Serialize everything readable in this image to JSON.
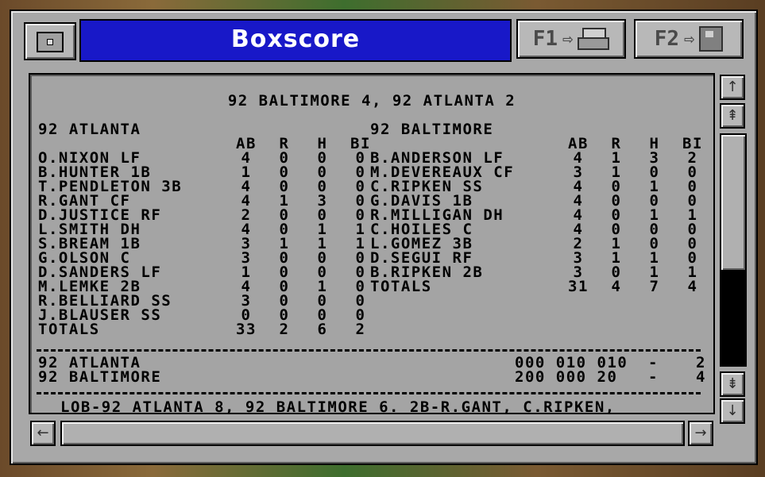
{
  "window": {
    "title": "Boxscore",
    "f1_label": "F1",
    "f2_label": "F2",
    "f1_arrow": "⇨",
    "f2_arrow": "⇨"
  },
  "headline": "92 BALTIMORE 4, 92 ATLANTA 2",
  "columns": {
    "ab": "AB",
    "r": "R",
    "h": "H",
    "bi": "BI"
  },
  "away": {
    "team": "92 ATLANTA",
    "players": [
      {
        "name": "O.NIXON LF",
        "ab": "4",
        "r": "0",
        "h": "0",
        "bi": "0"
      },
      {
        "name": "B.HUNTER 1B",
        "ab": "1",
        "r": "0",
        "h": "0",
        "bi": "0"
      },
      {
        "name": "T.PENDLETON 3B",
        "ab": "4",
        "r": "0",
        "h": "0",
        "bi": "0"
      },
      {
        "name": "R.GANT CF",
        "ab": "4",
        "r": "1",
        "h": "3",
        "bi": "0"
      },
      {
        "name": "D.JUSTICE RF",
        "ab": "2",
        "r": "0",
        "h": "0",
        "bi": "0"
      },
      {
        "name": "L.SMITH DH",
        "ab": "4",
        "r": "0",
        "h": "1",
        "bi": "1"
      },
      {
        "name": "S.BREAM 1B",
        "ab": "3",
        "r": "1",
        "h": "1",
        "bi": "1"
      },
      {
        "name": "G.OLSON C",
        "ab": "3",
        "r": "0",
        "h": "0",
        "bi": "0"
      },
      {
        "name": "D.SANDERS LF",
        "ab": "1",
        "r": "0",
        "h": "0",
        "bi": "0"
      },
      {
        "name": "M.LEMKE 2B",
        "ab": "4",
        "r": "0",
        "h": "1",
        "bi": "0"
      },
      {
        "name": "R.BELLIARD SS",
        "ab": "3",
        "r": "0",
        "h": "0",
        "bi": "0"
      },
      {
        "name": "J.BLAUSER SS",
        "ab": "0",
        "r": "0",
        "h": "0",
        "bi": "0"
      }
    ],
    "totals": {
      "name": "TOTALS",
      "ab": "33",
      "r": "2",
      "h": "6",
      "bi": "2"
    }
  },
  "home": {
    "team": "92 BALTIMORE",
    "players": [
      {
        "name": "B.ANDERSON LF",
        "ab": "4",
        "r": "1",
        "h": "3",
        "bi": "2"
      },
      {
        "name": "M.DEVEREAUX CF",
        "ab": "3",
        "r": "1",
        "h": "0",
        "bi": "0"
      },
      {
        "name": "C.RIPKEN SS",
        "ab": "4",
        "r": "0",
        "h": "1",
        "bi": "0"
      },
      {
        "name": "G.DAVIS 1B",
        "ab": "4",
        "r": "0",
        "h": "0",
        "bi": "0"
      },
      {
        "name": "R.MILLIGAN DH",
        "ab": "4",
        "r": "0",
        "h": "1",
        "bi": "1"
      },
      {
        "name": "C.HOILES C",
        "ab": "4",
        "r": "0",
        "h": "0",
        "bi": "0"
      },
      {
        "name": "L.GOMEZ 3B",
        "ab": "2",
        "r": "1",
        "h": "0",
        "bi": "0"
      },
      {
        "name": "D.SEGUI RF",
        "ab": "3",
        "r": "1",
        "h": "1",
        "bi": "0"
      },
      {
        "name": "B.RIPKEN 2B",
        "ab": "3",
        "r": "0",
        "h": "1",
        "bi": "1"
      }
    ],
    "totals": {
      "name": "TOTALS",
      "ab": "31",
      "r": "4",
      "h": "7",
      "bi": "4"
    }
  },
  "linescore": [
    {
      "team": "92 ATLANTA",
      "innings": "000 010 010",
      "dash": "-",
      "total": "2"
    },
    {
      "team": "92 BALTIMORE",
      "innings": "200 000 20",
      "dash": "-",
      "total": "4"
    }
  ],
  "notes": "LOB-92 ATLANTA 8, 92 BALTIMORE 6. 2B-R.GANT, C.RIPKEN,",
  "icons": {
    "system_menu": "system-menu-icon",
    "print": "printer-icon",
    "save": "disk-icon",
    "scroll_up": "arrow-up-icon",
    "page_up": "page-up-icon",
    "page_down": "page-down-icon",
    "scroll_down": "arrow-down-icon",
    "scroll_left": "arrow-left-icon",
    "scroll_right": "arrow-right-icon"
  },
  "vertical_scroll_thumb_position": 0
}
